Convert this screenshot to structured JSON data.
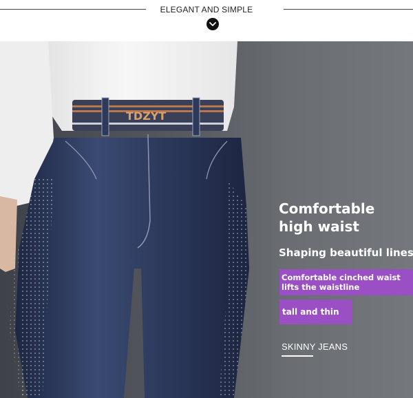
{
  "header": {
    "title": "ELEGANT AND SIMPLE",
    "icon": "chevron-down-icon"
  },
  "product": {
    "waistband_brand": "TDZYT"
  },
  "copy": {
    "headline": "Comfortable high waist",
    "subline": "Shaping beautiful lines",
    "tag_primary": "Comfortable cinched waist lifts the waistline",
    "tag_secondary": "tall and thin",
    "category": "SKINNY JEANS"
  },
  "colors": {
    "tag_background": "#9b4fc4",
    "background_gray": "#5a5e63",
    "denim": "#2d3a5c"
  }
}
